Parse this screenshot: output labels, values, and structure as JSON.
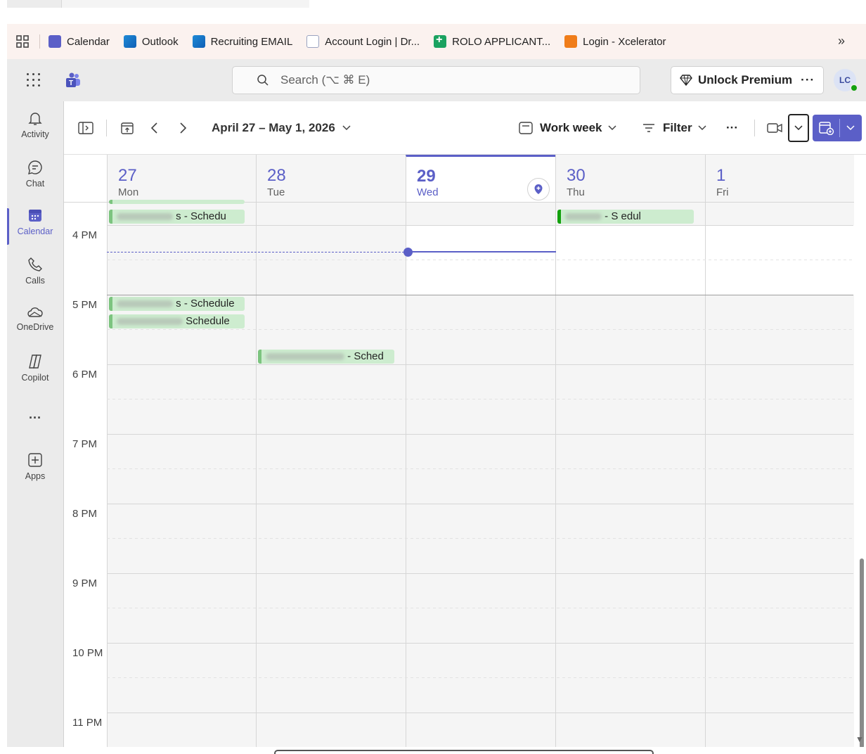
{
  "bookmarks": {
    "apps_icon": "apps-grid-icon",
    "items": [
      {
        "label": "Calendar",
        "icon": "teams-icon"
      },
      {
        "label": "Outlook",
        "icon": "outlook-icon"
      },
      {
        "label": "Recruiting EMAIL",
        "icon": "outlook-icon"
      },
      {
        "label": "Account Login | Dr...",
        "icon": "document-icon"
      },
      {
        "label": "ROLO APPLICANT...",
        "icon": "sheets-icon"
      },
      {
        "label": "Login - Xcelerator",
        "icon": "xcelerator-icon"
      }
    ],
    "overflow": "»"
  },
  "header": {
    "search_placeholder": "Search (⌥ ⌘ E)",
    "premium_label": "Unlock Premium",
    "premium_more": "···",
    "avatar_initials": "LC"
  },
  "rail": {
    "items": [
      {
        "label": "Activity",
        "icon": "bell-icon"
      },
      {
        "label": "Chat",
        "icon": "chat-icon"
      },
      {
        "label": "Calendar",
        "icon": "calendar-icon",
        "active": true
      },
      {
        "label": "Calls",
        "icon": "phone-icon"
      },
      {
        "label": "OneDrive",
        "icon": "cloud-icon"
      },
      {
        "label": "Copilot",
        "icon": "copilot-icon"
      },
      {
        "label": "···",
        "icon": "more-icon"
      },
      {
        "label": "Apps",
        "icon": "add-apps-icon"
      }
    ]
  },
  "toolbar": {
    "date_range": "April 27 – May 1, 2026",
    "view_label": "Work week",
    "filter_label": "Filter",
    "more": "···"
  },
  "days": [
    {
      "num": "27",
      "name": "Mon"
    },
    {
      "num": "28",
      "name": "Tue"
    },
    {
      "num": "29",
      "name": "Wed",
      "today": true
    },
    {
      "num": "30",
      "name": "Thu"
    },
    {
      "num": "1",
      "name": "Fri"
    }
  ],
  "times": [
    "4 PM",
    "5 PM",
    "6 PM",
    "7 PM",
    "8 PM",
    "9 PM",
    "10 PM",
    "11 PM"
  ],
  "events": [
    {
      "day": "Mon",
      "suffix": "s - Schedu"
    },
    {
      "day": "Thu",
      "suffix": "- S   edul"
    },
    {
      "day": "Mon",
      "suffix": "s - Schedule"
    },
    {
      "day": "Mon",
      "suffix": "Schedule"
    },
    {
      "day": "Tue",
      "suffix": "- Sched"
    }
  ],
  "colors": {
    "accent": "#5b5fc7",
    "event_bg": "#cdeccf",
    "event_border": "#7cc47f"
  }
}
